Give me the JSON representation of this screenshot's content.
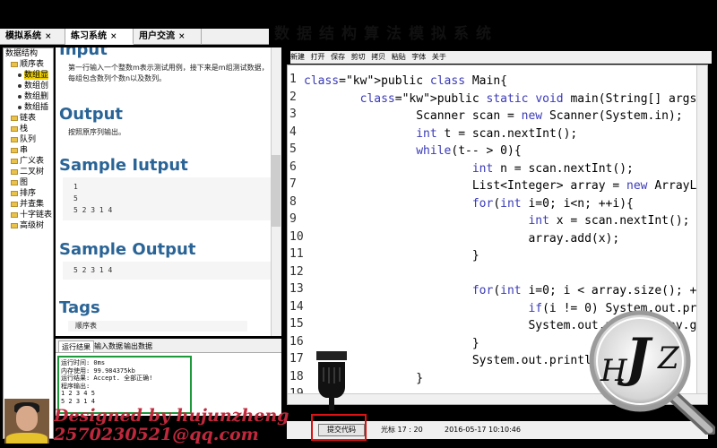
{
  "tabs": [
    {
      "label": "模拟系统",
      "close": "×"
    },
    {
      "label": "练习系统",
      "close": "×"
    },
    {
      "label": "用户交流",
      "close": "×"
    }
  ],
  "banner_text": "数据结构算法模拟系统",
  "sidebar": {
    "items": [
      {
        "label": "数据结构",
        "kind": "plain",
        "depth": 0
      },
      {
        "label": "顺序表",
        "kind": "folder",
        "depth": 1
      },
      {
        "label": "数组显",
        "kind": "leaf",
        "depth": 2,
        "selected": true
      },
      {
        "label": "数组创",
        "kind": "leaf",
        "depth": 2
      },
      {
        "label": "数组删",
        "kind": "leaf",
        "depth": 2
      },
      {
        "label": "数组插",
        "kind": "leaf",
        "depth": 2
      },
      {
        "label": "链表",
        "kind": "folder",
        "depth": 1
      },
      {
        "label": "栈",
        "kind": "folder",
        "depth": 1
      },
      {
        "label": "队列",
        "kind": "folder",
        "depth": 1
      },
      {
        "label": "串",
        "kind": "folder",
        "depth": 1
      },
      {
        "label": "广义表",
        "kind": "folder",
        "depth": 1
      },
      {
        "label": "二叉树",
        "kind": "folder",
        "depth": 1
      },
      {
        "label": "图",
        "kind": "folder",
        "depth": 1
      },
      {
        "label": "排序",
        "kind": "folder",
        "depth": 1
      },
      {
        "label": "并查集",
        "kind": "folder",
        "depth": 1
      },
      {
        "label": "十字链表",
        "kind": "folder",
        "depth": 1
      },
      {
        "label": "高级树",
        "kind": "folder",
        "depth": 1
      }
    ]
  },
  "problem": {
    "input_heading": "Input",
    "input_text": "第一行输入一个整数m表示测试用例，接下来是m组测试数据，每组包含数列个数n以及数列。",
    "output_heading": "Output",
    "output_text": "按照原序列输出。",
    "sample_input_heading": "Sample Iutput",
    "sample_input_lines": [
      "1",
      "5",
      "5 2 3 1 4"
    ],
    "sample_output_heading": "Sample Output",
    "sample_output_lines": [
      "5 2 3 1 4"
    ],
    "tags_heading": "Tags",
    "tags_text": "顺序表"
  },
  "result_tabs": [
    {
      "label": "运行结果",
      "active": true
    },
    {
      "label": "输入数据",
      "active": false
    },
    {
      "label": "输出数据",
      "active": false
    }
  ],
  "result_lines": [
    "运行时间: 0ms",
    "内存使用: 99.984375kb",
    "运行结果: Accept. 全部正确!",
    "程序输出:",
    "1 2 3 4 5",
    "5 2 3 1 4"
  ],
  "toolbar": [
    "新建",
    "打开",
    "保存",
    "剪切",
    "拷贝",
    "粘贴",
    "字体",
    "关于"
  ],
  "code_lines": [
    {
      "n": "1",
      "t": "public class Main{"
    },
    {
      "n": "2",
      "t": "        public static void main(String[] args){"
    },
    {
      "n": "3",
      "t": "                Scanner scan = new Scanner(System.in);"
    },
    {
      "n": "4",
      "t": "                int t = scan.nextInt();"
    },
    {
      "n": "5",
      "t": "                while(t-- > 0){"
    },
    {
      "n": "6",
      "t": "                        int n = scan.nextInt();"
    },
    {
      "n": "7",
      "t": "                        List<Integer> array = new ArrayList<Integer>();"
    },
    {
      "n": "8",
      "t": "                        for(int i=0; i<n; ++i){"
    },
    {
      "n": "9",
      "t": "                                int x = scan.nextInt();"
    },
    {
      "n": "10",
      "t": "                                array.add(x);"
    },
    {
      "n": "11",
      "t": "                        }"
    },
    {
      "n": "12",
      "t": ""
    },
    {
      "n": "13",
      "t": "                        for(int i=0; i < array.size(); ++i){"
    },
    {
      "n": "14",
      "t": "                                if(i != 0) System.out.print(\" \");"
    },
    {
      "n": "15",
      "t": "                                System.out.print(array.get(i));"
    },
    {
      "n": "16",
      "t": "                        }"
    },
    {
      "n": "17",
      "t": "                        System.out.println();"
    },
    {
      "n": "18",
      "t": "                }"
    },
    {
      "n": "19",
      "t": ""
    }
  ],
  "status": {
    "submit_label": "提交代码",
    "cursor": "光标 17 : 20",
    "timestamp": "2016-05-17 10:10:46"
  },
  "watermark": {
    "designer": "Designed by  hujunzheng",
    "email": "2570230521@qq.com",
    "logo": "HJZ"
  },
  "colors": {
    "keyword": "#3a3ab8",
    "heading": "#2a6496",
    "highlight_red": "#d11",
    "highlight_green": "#1c9a3a"
  }
}
